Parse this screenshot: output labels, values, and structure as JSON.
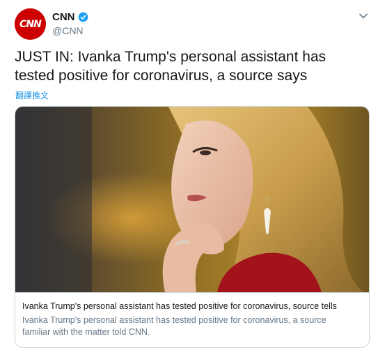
{
  "tweet": {
    "avatar_text": "CNN",
    "display_name": "CNN",
    "handle": "@CNN",
    "text": "JUST IN: Ivanka Trump's personal assistant has tested positive for coronavirus, a source says",
    "translate_label": "翻譯推文"
  },
  "card": {
    "title": "Ivanka Trump's personal assistant has tested positive for coronavirus, source tells",
    "description": "Ivanka Trump's personal assistant has tested positive for coronavirus, a source familiar with the matter told CNN."
  },
  "colors": {
    "brand_red": "#cc0000",
    "link_blue": "#1b95e0",
    "verified_blue": "#1da1f2",
    "muted": "#657786"
  },
  "icons": [
    "verified-badge-icon",
    "chevron-down-icon"
  ]
}
